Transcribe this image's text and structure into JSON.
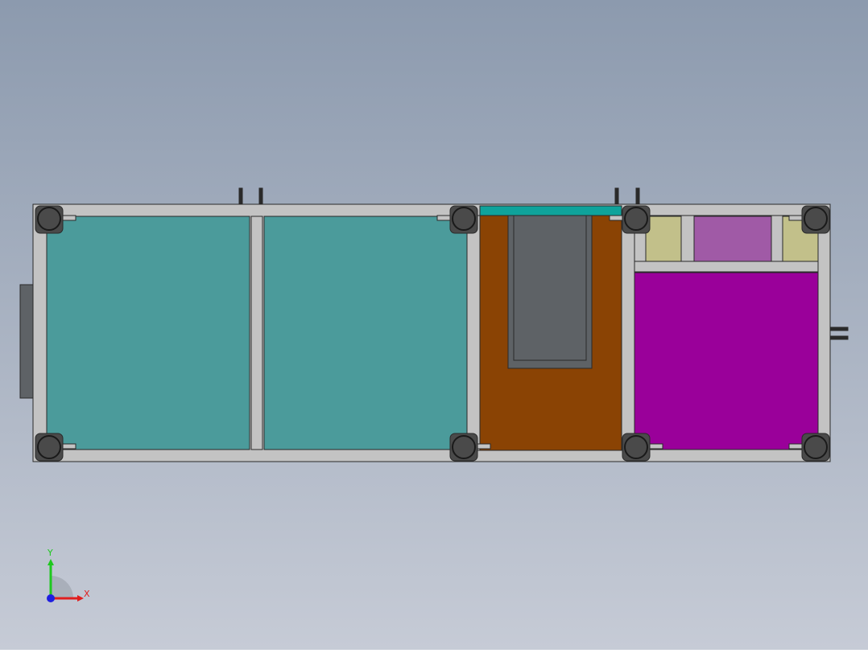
{
  "colors": {
    "bg_top": "#8c9aae",
    "bg_bottom": "#c6cbd6",
    "frame": "#c3c3c3",
    "frame_edge": "#2a2a2a",
    "teal_panel": "#4b9b9b",
    "brown_panel": "#8a4304",
    "magenta_panel": "#9a009a",
    "dark_plate": "#5e6266",
    "olive_component": "#c2c08a",
    "violet_board": "#a05aa6",
    "teal_strip": "#0fa39b",
    "caster": "#4a4a4a",
    "side_panel": "#5e6266",
    "axis_x": "#e01e1e",
    "axis_y": "#1ec81e",
    "axis_z": "#1e1ee0"
  },
  "triad": {
    "x_label": "X",
    "y_label": "Y"
  }
}
